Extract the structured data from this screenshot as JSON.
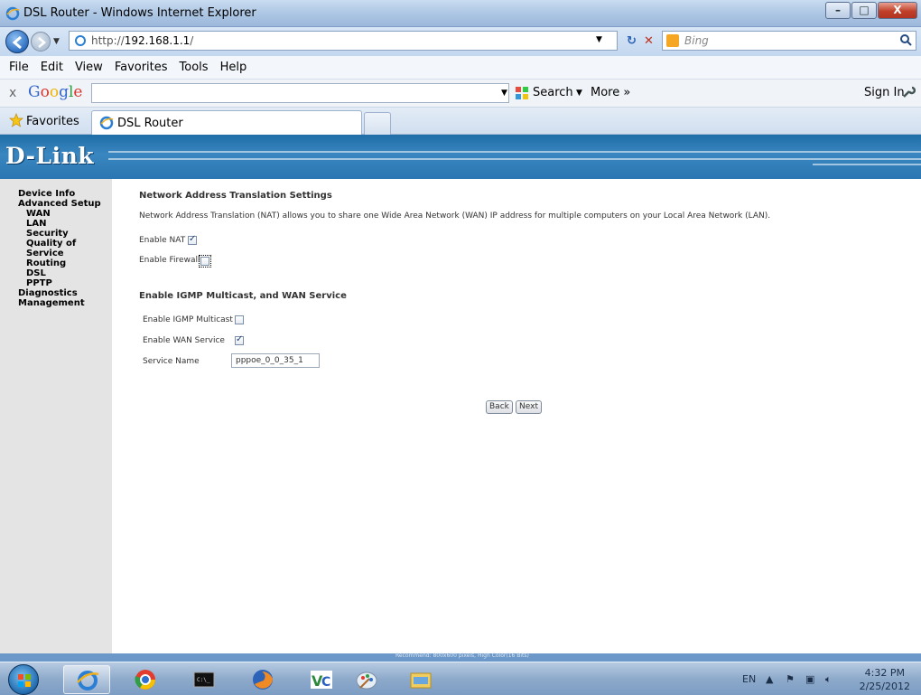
{
  "window": {
    "title": "DSL Router - Windows Internet Explorer",
    "minimize": "–",
    "maximize": "□",
    "close": "X"
  },
  "address_bar": {
    "url_prefix": "http://",
    "url_host": "192.168.1.1",
    "url_suffix": "/",
    "search_placeholder": "Bing"
  },
  "menu": [
    "File",
    "Edit",
    "View",
    "Favorites",
    "Tools",
    "Help"
  ],
  "google_toolbar": {
    "close": "x",
    "logo": "Google",
    "search_label": "Search",
    "more_label": "More »",
    "signin_label": "Sign In"
  },
  "favorites_bar": {
    "favorites_label": "Favorites",
    "tab_title": "DSL Router"
  },
  "router": {
    "brand": "D-Link",
    "sidebar": [
      {
        "label": "Device Info",
        "level": 0
      },
      {
        "label": "Advanced Setup",
        "level": 0
      },
      {
        "label": "WAN",
        "level": 1
      },
      {
        "label": "LAN",
        "level": 1
      },
      {
        "label": "Security",
        "level": 1
      },
      {
        "label": "Quality of Service",
        "level": 1
      },
      {
        "label": "Routing",
        "level": 1
      },
      {
        "label": "DSL",
        "level": 1
      },
      {
        "label": "PPTP",
        "level": 1
      },
      {
        "label": "Diagnostics",
        "level": 0
      },
      {
        "label": "Management",
        "level": 0
      }
    ],
    "nat_section": {
      "heading": "Network Address Translation Settings",
      "description": "Network Address Translation (NAT) allows you to share one Wide Area Network (WAN) IP address for multiple computers on your Local Area Network (LAN).",
      "enable_nat_label": "Enable NAT",
      "enable_nat_checked": true,
      "enable_firewall_label": "Enable Firewall",
      "enable_firewall_checked": false
    },
    "igmp_section": {
      "heading": "Enable IGMP Multicast, and WAN Service",
      "igmp_label": "Enable IGMP Multicast",
      "igmp_checked": false,
      "wan_service_label": "Enable WAN Service",
      "wan_service_checked": true,
      "service_name_label": "Service Name",
      "service_name_value": "pppoe_0_0_35_1"
    },
    "buttons": {
      "back": "Back",
      "next": "Next"
    },
    "status_text": "Recommend: 800x600 pixels, High Color(16 Bits)"
  },
  "taskbar": {
    "language": "EN",
    "time": "4:32 PM",
    "date": "2/25/2012",
    "apps": [
      "internet-explorer-icon",
      "chrome-icon",
      "command-prompt-icon",
      "firefox-icon",
      "vnc-icon",
      "paint-icon",
      "file-explorer-icon"
    ]
  }
}
